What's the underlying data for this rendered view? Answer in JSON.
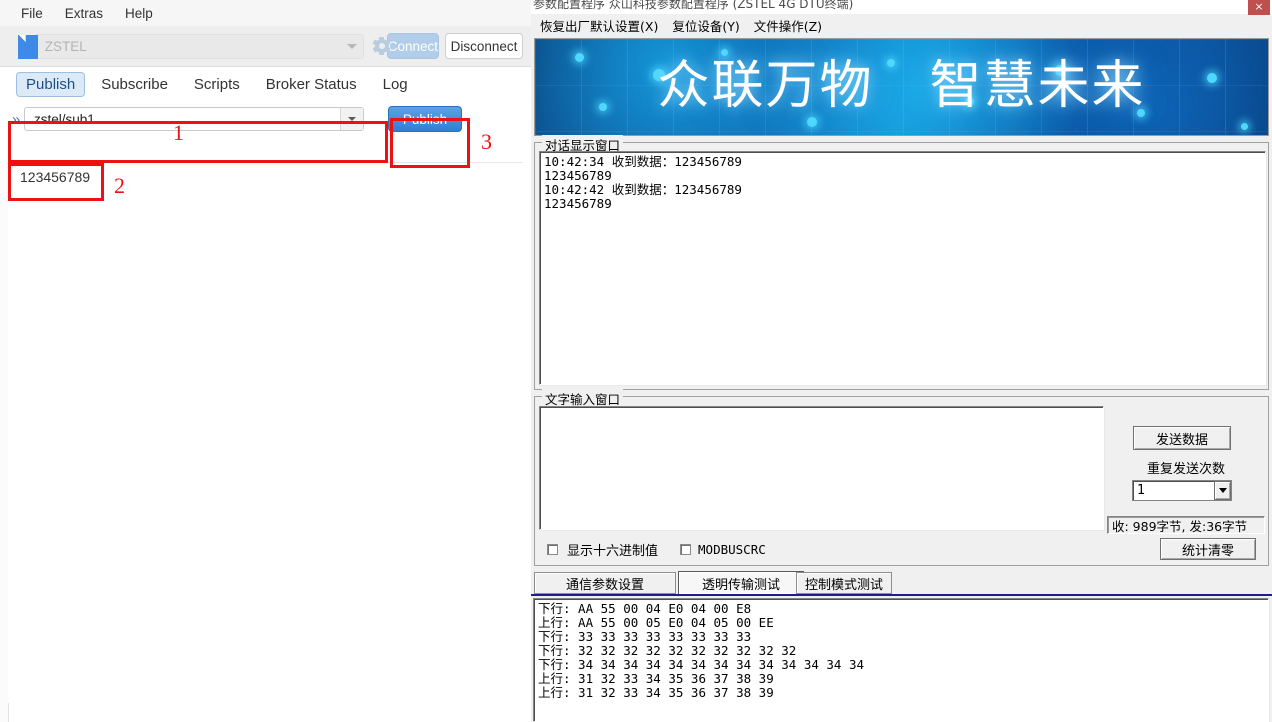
{
  "mqtt": {
    "menu": [
      "File",
      "Extras",
      "Help"
    ],
    "toolbar": {
      "profile_placeholder": "ZSTEL",
      "connect_label": "Connect",
      "disconnect_label": "Disconnect"
    },
    "tabs": [
      {
        "label": "Publish",
        "selected": true
      },
      {
        "label": "Subscribe",
        "selected": false
      },
      {
        "label": "Scripts",
        "selected": false
      },
      {
        "label": "Broker Status",
        "selected": false
      },
      {
        "label": "Log",
        "selected": false
      }
    ],
    "publish": {
      "topic_value": "zstel/sub1",
      "publish_label": "Publish",
      "payload_value": "123456789"
    },
    "annotations": [
      {
        "number": "1"
      },
      {
        "number": "2"
      },
      {
        "number": "3"
      }
    ]
  },
  "config_tool": {
    "title": "参数配置程序 众山科技参数配置程序 (ZSTEL 4G DTU终端)",
    "close_label": "×",
    "menu": [
      "恢复出厂默认设置(X)",
      "复位设备(Y)",
      "文件操作(Z)"
    ],
    "banner": {
      "left_text": "众联万物",
      "right_text": "智慧未来"
    },
    "dialog_group": {
      "label": "对话显示窗口",
      "lines": [
        "10:42:34 收到数据：123456789",
        "123456789",
        "10:42:42 收到数据：123456789",
        "123456789"
      ]
    },
    "input_group": {
      "label": "文字输入窗口",
      "value": ""
    },
    "send_panel": {
      "send_button": "发送数据",
      "repeat_label": "重复发送次数",
      "repeat_value": "1",
      "stats_text": "收: 989字节, 发:36字节"
    },
    "options": {
      "hex_label": "显示十六进制值",
      "hex_checked": false,
      "modbus_label": "MODBUSCRC",
      "modbus_checked": false,
      "clear_button": "统计清零"
    },
    "tabs": [
      {
        "label": "通信参数设置",
        "active": false
      },
      {
        "label": "透明传输测试",
        "active": true
      },
      {
        "label": "控制模式测试",
        "active": false
      }
    ],
    "hex_log": [
      "下行: AA 55 00 04 E0 04 00 E8",
      "上行: AA 55 00 05 E0 04 05 00 EE",
      "下行: 33 33 33 33 33 33 33 33",
      "下行: 32 32 32 32 32 32 32 32 32 32",
      "下行: 34 34 34 34 34 34 34 34 34 34 34 34 34",
      "上行: 31 32 33 34 35 36 37 38 39",
      "上行: 31 32 33 34 35 36 37 38 39"
    ]
  },
  "colors": {
    "accent_blue": "#2f7fd4",
    "annotation_red": "#ee1111",
    "banner_blue": "#0b4f9e",
    "close_red": "#c0504d"
  }
}
